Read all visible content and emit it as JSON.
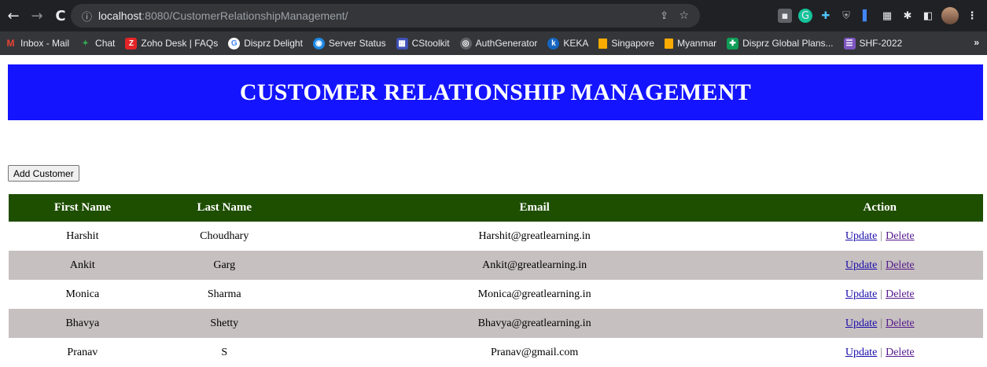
{
  "browser": {
    "url_host": "localhost",
    "url_path": ":8080/CustomerRelationshipManagement/",
    "bookmarks": [
      {
        "label": "Inbox - Mail",
        "icon": "M",
        "color": "#1a73e8"
      },
      {
        "label": "Chat",
        "icon": "✦",
        "color": "#34a853"
      },
      {
        "label": "Zoho Desk | FAQs",
        "icon": "Z",
        "color": "#e42527"
      },
      {
        "label": "Disprz Delight",
        "icon": "G",
        "color": "#4285f4"
      },
      {
        "label": "Server Status",
        "icon": "◉",
        "color": "#1e88e5"
      },
      {
        "label": "CStoolkit",
        "icon": "▦",
        "color": "#3f51b5"
      },
      {
        "label": "AuthGenerator",
        "icon": "◎",
        "color": "#757575"
      },
      {
        "label": "KEKA",
        "icon": "k",
        "color": "#1565c0"
      },
      {
        "label": "Singapore",
        "icon": "",
        "color": "#f9ab00"
      },
      {
        "label": "Myanmar",
        "icon": "",
        "color": "#f9ab00"
      },
      {
        "label": "Disprz Global Plans...",
        "icon": "✚",
        "color": "#0f9d58"
      },
      {
        "label": "SHF-2022",
        "icon": "☰",
        "color": "#7e57c2"
      }
    ],
    "more": "»"
  },
  "page": {
    "title": "CUSTOMER RELATIONSHIP MANAGEMENT",
    "add_button": "Add Customer"
  },
  "table": {
    "headers": {
      "first": "First Name",
      "last": "Last Name",
      "email": "Email",
      "action": "Action"
    },
    "rows": [
      {
        "first": "Harshit",
        "last": "Choudhary",
        "email": "Harshit@greatlearning.in",
        "update": "Update",
        "delete": "Delete"
      },
      {
        "first": "Ankit",
        "last": "Garg",
        "email": "Ankit@greatlearning.in",
        "update": "Update",
        "delete": "Delete"
      },
      {
        "first": "Monica",
        "last": "Sharma",
        "email": "Monica@greatlearning.in",
        "update": "Update",
        "delete": "Delete"
      },
      {
        "first": "Bhavya",
        "last": "Shetty",
        "email": "Bhavya@greatlearning.in",
        "update": "Update",
        "delete": "Delete"
      },
      {
        "first": "Pranav",
        "last": "S",
        "email": "Pranav@gmail.com",
        "update": "Update",
        "delete": "Delete"
      }
    ]
  },
  "colors": {
    "banner": "#1414ff",
    "header_row": "#1e4e00",
    "alt_row": "#c7c0c0"
  }
}
